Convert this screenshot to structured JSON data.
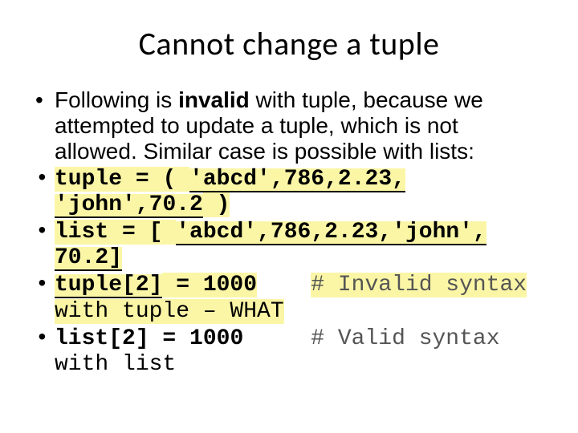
{
  "title": "Cannot change a tuple",
  "intro": {
    "t1": "Following is ",
    "t2": "invalid",
    "t3": " with tuple, because we attempted to update a tuple, which is not allowed. Similar case is possible with lists:"
  },
  "code": {
    "tuple_kw": "tuple",
    "eq": " = ",
    "lparen": "( ",
    "rparen": " )",
    "abcd": "'abcd'",
    "c1": ", ",
    "n786": "786 ",
    "n223": "2.23",
    "john": "'john'",
    "n702": "70.2 ",
    "list_kw": "list",
    "lbrack": "[ ",
    "rbrack_u": " ]",
    "tuple_idx": "tuple[2]",
    "assign1000": " = 1000",
    "list_idx": "list[2]",
    "invalid_comment": "# Invalid syntax",
    "valid_comment": "# Valid syntax",
    "with_tuple_what": "with tuple – WHAT",
    "with_list": "with list"
  }
}
